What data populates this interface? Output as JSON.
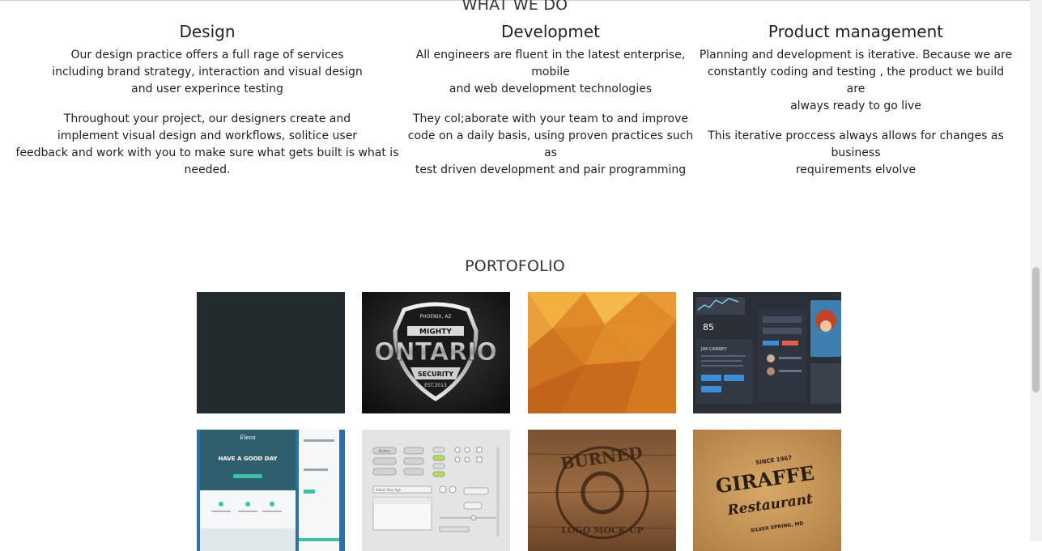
{
  "what_we_do": {
    "title": "WHAT WE DO",
    "columns": [
      {
        "heading": "Design",
        "p1": [
          "Our design practice offers a full rage of services",
          "including brand strategy, interaction and visual design",
          "and user experince testing"
        ],
        "p2": [
          "Throughout your project, our designers create and",
          "implement visual design and workflows, solitice user",
          "feedback and work with you to make sure what gets built is what is needed."
        ]
      },
      {
        "heading": "Developmet",
        "p1": [
          "All engineers are fluent in the latest enterprise, mobile",
          "and web development technologies"
        ],
        "p2": [
          "They col;aborate with your team to and improve",
          "code on a daily basis, using proven practices such as",
          "test driven development and pair programming"
        ]
      },
      {
        "heading": "Product management",
        "p1": [
          "Planning and development is iterative. Because we are",
          "constantly coding and testing , the product we build are",
          "always ready to go live"
        ],
        "p2": [
          "This iterative proccess always allows for changes as business",
          "requirements elvolve"
        ]
      }
    ]
  },
  "portfolio": {
    "title": "PORTOFOLIO",
    "items": [
      {
        "name": "dark-slate-tile",
        "color": "#232b2e"
      },
      {
        "name": "mighty-ontario-security-badge",
        "top_text": "PHOENIX, AZ",
        "banner": "MIGHTY",
        "main": "ONTARIO",
        "ribbon": "SECURITY",
        "year": "EST.2013"
      },
      {
        "name": "orange-polygon-tile",
        "color": "#e08a2a"
      },
      {
        "name": "dark-ui-kit-tile",
        "temp": "85",
        "name_text": "JIM CARREY"
      },
      {
        "name": "website-mockup-tile",
        "brand": "Eleca",
        "headline": "HAVE A GOOD DAY"
      },
      {
        "name": "light-ui-controls-tile",
        "button_label": "Button",
        "select_label": "Select Your Age"
      },
      {
        "name": "burned-logo-mockup-tile",
        "top_text": "BURNED",
        "bottom_text": "LOGO MOCK-UP"
      },
      {
        "name": "giraffe-restaurant-tile",
        "since": "SINCE 1967",
        "main": "GIRAFFE",
        "script": "Restaurant",
        "place": "SILVER SPRING, MD"
      }
    ]
  }
}
